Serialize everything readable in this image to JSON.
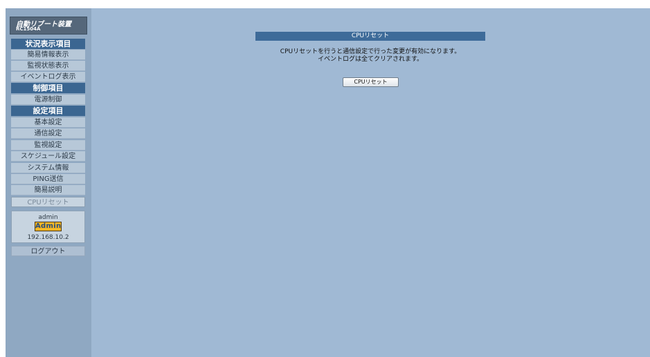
{
  "sidebar": {
    "brand_title": "自動リブート装置",
    "brand_model": "RC1504A",
    "items": [
      {
        "label": "状況表示項目",
        "type": "heading"
      },
      {
        "label": "簡易情報表示",
        "type": "link"
      },
      {
        "label": "監視状態表示",
        "type": "link"
      },
      {
        "label": "イベントログ表示",
        "type": "link"
      },
      {
        "label": "制御項目",
        "type": "heading"
      },
      {
        "label": "電源制御",
        "type": "link"
      },
      {
        "label": "設定項目",
        "type": "heading"
      },
      {
        "label": "基本設定",
        "type": "link"
      },
      {
        "label": "通信設定",
        "type": "link"
      },
      {
        "label": "監視設定",
        "type": "link"
      },
      {
        "label": "スケジュール設定",
        "type": "link"
      },
      {
        "label": "システム情報",
        "type": "link"
      },
      {
        "label": "PING送信",
        "type": "link"
      },
      {
        "label": "簡易説明",
        "type": "link"
      },
      {
        "label": "CPUリセット",
        "type": "active"
      }
    ],
    "user": {
      "name": "admin",
      "badge": "Admin",
      "ip": "192.168.10.2"
    },
    "logout_label": "ログアウト"
  },
  "main": {
    "header": "CPUリセット",
    "description_line1": "CPUリセットを行うと通信設定で行った変更が有効になります。",
    "description_line2": "イベントログは全てクリアされます。",
    "button_label": "CPUリセット"
  },
  "colors": {
    "page_background": "#a0b9d4",
    "sidebar_background": "#8fa8c2",
    "heading_blue": "#3b6691",
    "admin_badge": "#f3b623"
  }
}
